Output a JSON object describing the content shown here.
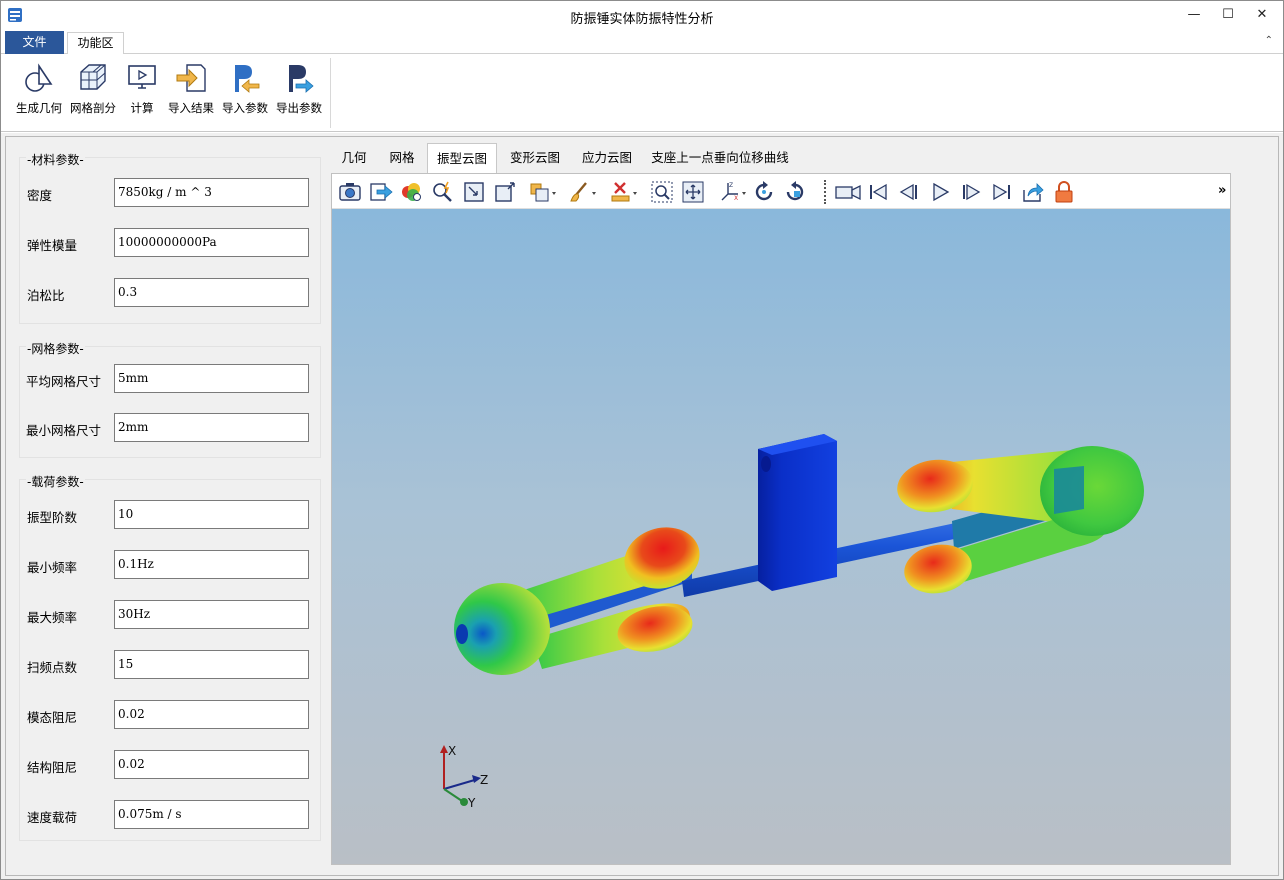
{
  "window": {
    "title": "防振锤实体防振特性分析",
    "buttons": {
      "minimize": "—",
      "maximize": "☐",
      "close": "✕"
    }
  },
  "ribbon": {
    "tabs": {
      "file": "文件",
      "function": "功能区"
    },
    "collapse_glyph": "⌃",
    "buttons": [
      {
        "label": "生成几何",
        "icon": "geometry-shapes-icon"
      },
      {
        "label": "网格剖分",
        "icon": "mesh-cube-icon"
      },
      {
        "label": "计算",
        "icon": "monitor-play-icon"
      },
      {
        "label": "导入结果",
        "icon": "import-arrow-icon"
      },
      {
        "label": "导入参数",
        "icon": "parameter-import-icon"
      },
      {
        "label": "导出参数",
        "icon": "parameter-export-icon"
      }
    ]
  },
  "material": {
    "title": "-材料参数-",
    "fields": [
      {
        "label": "密度",
        "value": "7850kg / m ^ 3"
      },
      {
        "label": "弹性模量",
        "value": "10000000000Pa"
      },
      {
        "label": "泊松比",
        "value": "0.3"
      }
    ]
  },
  "mesh": {
    "title": "-网格参数-",
    "fields": [
      {
        "label": "平均网格尺寸",
        "value": "5mm"
      },
      {
        "label": "最小网格尺寸",
        "value": "2mm"
      }
    ]
  },
  "load": {
    "title": "-载荷参数-",
    "fields": [
      {
        "label": "振型阶数",
        "value": "10"
      },
      {
        "label": "最小频率",
        "value": "0.1Hz"
      },
      {
        "label": "最大频率",
        "value": "30Hz"
      },
      {
        "label": "扫频点数",
        "value": "15"
      },
      {
        "label": "模态阻尼",
        "value": "0.02"
      },
      {
        "label": "结构阻尼",
        "value": "0.02"
      },
      {
        "label": "速度载荷",
        "value": "0.075m / s"
      }
    ]
  },
  "view_tabs": [
    "几何",
    "网格",
    "振型云图",
    "变形云图",
    "应力云图",
    "支座上一点垂向位移曲线"
  ],
  "active_view_tab": "振型云图",
  "toolbar": {
    "overflow_glyph": "»",
    "icons": [
      "camera-icon",
      "export-icon",
      "color-map-icon",
      "zoom-flash-icon",
      "fit-view-icon",
      "fit-corner-icon",
      "box-select-icon",
      "brush-icon",
      "clear-icon",
      "zoom-window-icon",
      "pan-icon",
      "axis-icon",
      "rotate-cw-icon",
      "rotate-ccw-icon",
      "record-icon",
      "first-frame-icon",
      "prev-frame-icon",
      "play-icon",
      "next-frame-icon",
      "last-frame-icon",
      "share-icon",
      "lock-icon"
    ]
  },
  "axes": {
    "x": "X",
    "y": "Y",
    "z": "Z"
  },
  "colors": {
    "file_tab": "#2b579a",
    "rod": "#1b55d8",
    "clamp": "#0a2fc8"
  }
}
